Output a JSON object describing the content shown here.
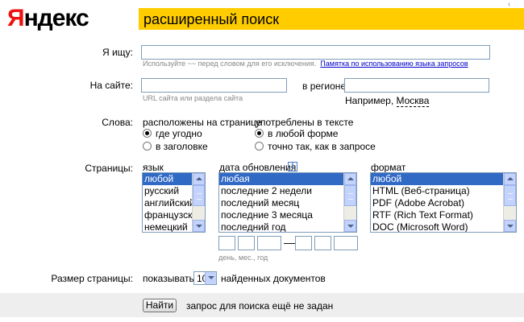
{
  "header": {
    "logo_first": "Я",
    "logo_rest": "ндекс",
    "title": "расширенный поиск",
    "corner_mark": "‹"
  },
  "search": {
    "label": "Я ищу:",
    "value": "",
    "hint": "Используйте ~~ перед словом для его исключения.",
    "hint_link": "Памятка по использованию языка запросов"
  },
  "site": {
    "label": "На сайте:",
    "value": "",
    "hint": "URL сайта или раздела сайта",
    "region_label": "в регионе",
    "region_value": "",
    "region_example_prefix": "Например,",
    "region_example_link": "Москва"
  },
  "words": {
    "label": "Слова:",
    "location_heading": "расположены на странице",
    "location_options": [
      {
        "label": "где угодно",
        "checked": true
      },
      {
        "label": "в заголовке",
        "checked": false
      }
    ],
    "form_heading": "употреблены в тексте",
    "form_options": [
      {
        "label": "в любой форме",
        "checked": true
      },
      {
        "label": "точно так, как в запросе",
        "checked": false
      }
    ]
  },
  "pages": {
    "label": "Страницы:",
    "language": {
      "heading": "язык",
      "options": [
        "любой",
        "русский",
        "английский",
        "французский",
        "немецкий"
      ],
      "selected": "любой"
    },
    "date": {
      "heading": "дата обновления",
      "info_icon": "i",
      "options": [
        "любая",
        "последние 2 недели",
        "последний месяц",
        "последние 3 месяца",
        "последний год"
      ],
      "selected": "любая",
      "range_dash": "—",
      "range_hint": "день, мес., год"
    },
    "format": {
      "heading": "формат",
      "options": [
        "любой",
        "HTML (Веб-страница)",
        "PDF (Adobe Acrobat)",
        "RTF (Rich Text Format)",
        "DOC (Microsoft Word)"
      ],
      "selected": "любой"
    }
  },
  "page_size": {
    "label": "Размер страницы:",
    "prefix": "показывать",
    "value": "10",
    "suffix": "найденных документов"
  },
  "footer": {
    "button_label": "Найти",
    "status": "запрос для поиска ещё не задан"
  },
  "icons": {
    "scroll_up": "triangle-up-icon",
    "scroll_down": "triangle-down-icon",
    "dropdown": "chevron-down-icon",
    "info": "info-icon"
  },
  "colors": {
    "title_bar": "#ffcc00",
    "logo_accent": "#ee1111",
    "link": "#0000cc",
    "selection": "#316ac5",
    "footer_bar": "#eeeeee"
  }
}
